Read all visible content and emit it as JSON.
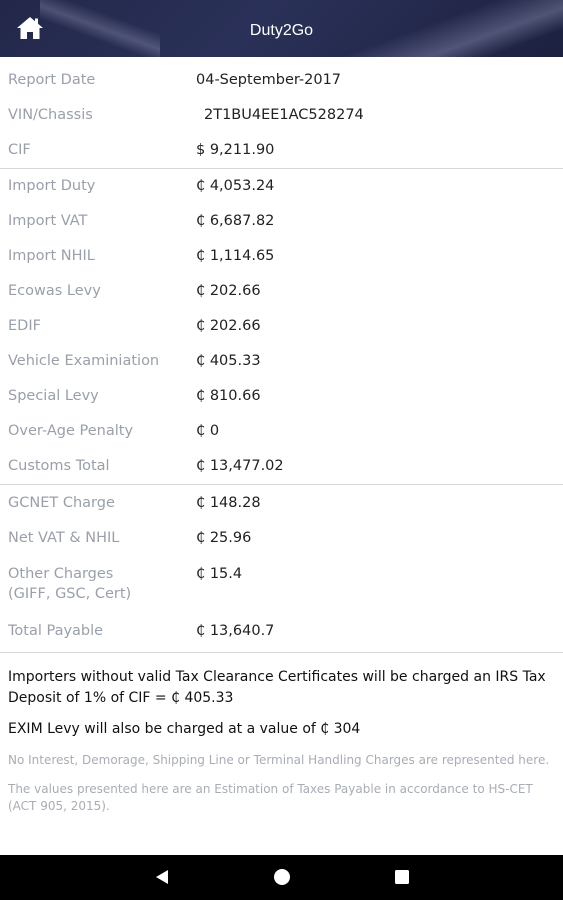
{
  "header": {
    "title": "Duty2Go",
    "home_icon": "home-icon"
  },
  "rows_group1": [
    {
      "label": "Report Date",
      "value": "04-September-2017"
    },
    {
      "label": "VIN/Chassis",
      "value": "2T1BU4EE1AC528274"
    },
    {
      "label": "CIF",
      "value": "$ 9,211.90"
    }
  ],
  "rows_group2": [
    {
      "label": "Import Duty",
      "value": "₵ 4,053.24"
    },
    {
      "label": "Import VAT",
      "value": "₵ 6,687.82"
    },
    {
      "label": "Import NHIL",
      "value": "₵ 1,114.65"
    },
    {
      "label": "Ecowas Levy",
      "value": "₵ 202.66"
    },
    {
      "label": "EDIF",
      "value": "₵ 202.66"
    },
    {
      "label": "Vehicle Examiniation",
      "value": "₵ 405.33"
    },
    {
      "label": "Special Levy",
      "value": "₵ 810.66"
    },
    {
      "label": "Over-Age Penalty",
      "value": "₵ 0"
    },
    {
      "label": "Customs Total",
      "value": "₵ 13,477.02"
    }
  ],
  "rows_group3": {
    "gcnet": {
      "label": "GCNET Charge",
      "value": "₵ 148.28"
    },
    "netvat": {
      "label": "Net VAT & NHIL",
      "value": "₵ 25.96"
    },
    "other": {
      "label_line1": "Other Charges",
      "label_line2": "(GIFF, GSC, Cert)",
      "value": "₵ 15.4"
    },
    "total": {
      "label": "Total Payable",
      "value": "₵ 13,640.7"
    }
  },
  "notes": {
    "irs": "Importers without valid Tax Clearance Certificates will be charged an IRS Tax Deposit of 1% of CIF = ₵ 405.33",
    "exim": "EXIM Levy will also be charged at a value of ₵ 304",
    "disclaimer1": "No Interest, Demorage, Shipping Line or  Terminal Handling Charges are represented here.",
    "disclaimer2": "The values presented here are an Estimation of Taxes Payable in accordance to HS-CET (ACT 905, 2015)."
  },
  "navbar": {
    "back_icon": "back-triangle-icon",
    "home_icon": "home-circle-icon",
    "recents_icon": "recents-square-icon"
  }
}
